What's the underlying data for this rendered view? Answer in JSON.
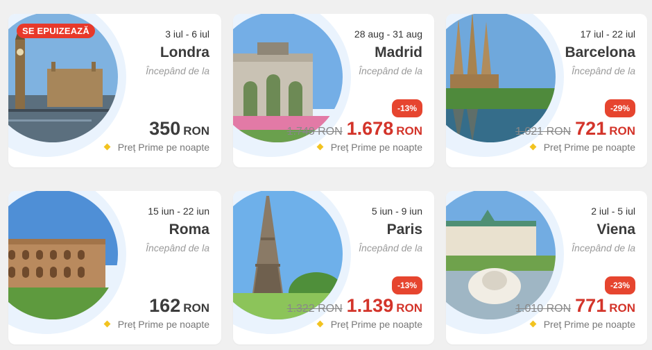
{
  "cards": [
    {
      "badge": "SE EPUIZEAZĂ",
      "dates": "3 iul - 6 iul",
      "city": "Londra",
      "from_label": "Începând de la",
      "old_price": "",
      "price": "350",
      "currency": "RON",
      "discount": "",
      "note": "Preț Prime pe noapte",
      "image": "london-big-ben"
    },
    {
      "badge": "",
      "dates": "28 aug - 31 aug",
      "city": "Madrid",
      "from_label": "Începând de la",
      "old_price": "1.748 RON",
      "price": "1.678",
      "currency": "RON",
      "discount": "-13%",
      "note": "Preț Prime pe noapte",
      "image": "madrid-puerta-de-alcala"
    },
    {
      "badge": "",
      "dates": "17 iul - 22 iul",
      "city": "Barcelona",
      "from_label": "Începând de la",
      "old_price": "1.021 RON",
      "price": "721",
      "currency": "RON",
      "discount": "-29%",
      "note": "Preț Prime pe noapte",
      "image": "barcelona-sagrada-familia"
    },
    {
      "badge": "",
      "dates": "15 iun - 22 iun",
      "city": "Roma",
      "from_label": "Începând de la",
      "old_price": "",
      "price": "162",
      "currency": "RON",
      "discount": "",
      "note": "Preț Prime pe noapte",
      "image": "rome-colosseum"
    },
    {
      "badge": "",
      "dates": "5 iun - 9 iun",
      "city": "Paris",
      "from_label": "Începând de la",
      "old_price": "1.322 RON",
      "price": "1.139",
      "currency": "RON",
      "discount": "-13%",
      "note": "Preț Prime pe noapte",
      "image": "paris-eiffel-tower"
    },
    {
      "badge": "",
      "dates": "2 iul - 5 iul",
      "city": "Viena",
      "from_label": "Începând de la",
      "old_price": "1.010 RON",
      "price": "771",
      "currency": "RON",
      "discount": "-23%",
      "note": "Preț Prime pe noapte",
      "image": "vienna-belvedere"
    }
  ],
  "colors": {
    "accent_red": "#d3342a",
    "badge_red": "#e8392a",
    "diamond": "#f2c320",
    "halo": "#eaf3fd"
  }
}
